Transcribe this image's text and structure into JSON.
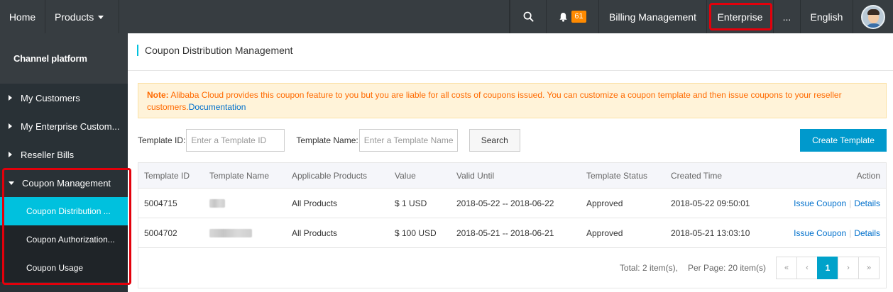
{
  "topbar": {
    "home": "Home",
    "products": "Products",
    "notification_count": "61",
    "billing": "Billing Management",
    "enterprise": "Enterprise",
    "more": "...",
    "language": "English"
  },
  "sidebar": {
    "title": "Channel platform",
    "items": [
      {
        "label": "My Customers"
      },
      {
        "label": "My Enterprise Custom..."
      },
      {
        "label": "Reseller Bills"
      }
    ],
    "group": {
      "label": "Coupon Management",
      "children": [
        {
          "label": "Coupon Distribution ..."
        },
        {
          "label": "Coupon Authorization..."
        },
        {
          "label": "Coupon Usage"
        }
      ]
    }
  },
  "main": {
    "title": "Coupon Distribution Management",
    "notice": {
      "prefix": "Note:",
      "text": " Alibaba Cloud provides this coupon feature to you but you are liable for all costs of coupons issued. You can customize a coupon template and then issue coupons to your reseller customers.",
      "link": "Documentation"
    },
    "filters": {
      "template_id_label": "Template ID:",
      "template_id_placeholder": "Enter a Template ID",
      "template_name_label": "Template Name:",
      "template_name_placeholder": "Enter a Template Name",
      "search_label": "Search",
      "create_label": "Create Template"
    },
    "table": {
      "columns": [
        "Template ID",
        "Template Name",
        "Applicable Products",
        "Value",
        "Valid Until",
        "Template Status",
        "Created Time",
        "Action"
      ],
      "rows": [
        {
          "id": "5004715",
          "name": "",
          "products": "All Products",
          "value": "$ 1 USD",
          "valid": "2018-05-22 -- 2018-06-22",
          "status": "Approved",
          "created": "2018-05-22 09:50:01"
        },
        {
          "id": "5004702",
          "name": "",
          "products": "All Products",
          "value": "$ 100 USD",
          "valid": "2018-05-21 -- 2018-06-21",
          "status": "Approved",
          "created": "2018-05-21 13:03:10"
        }
      ],
      "actions": {
        "issue": "Issue Coupon",
        "separator": "|",
        "details": "Details"
      }
    },
    "pagination": {
      "total": "Total: 2 item(s),",
      "per_page": "Per Page: 20 item(s)",
      "first": "«",
      "prev": "‹",
      "current": "1",
      "next": "›",
      "last": "»"
    }
  },
  "colors": {
    "topbar": "#373d41",
    "sidebar": "#293136",
    "active_item": "#00c1de",
    "primary_button": "#0099cc",
    "notice_text": "#ff6a00",
    "highlight_box": "#e3000b"
  }
}
